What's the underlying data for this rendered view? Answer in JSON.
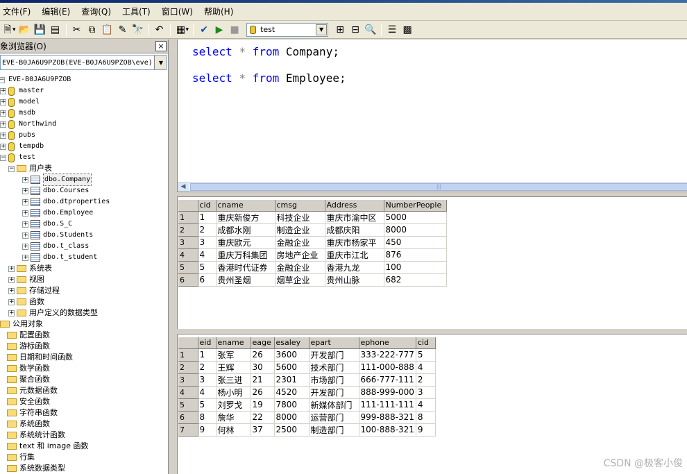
{
  "menu": [
    "文件(F)",
    "编辑(E)",
    "查询(Q)",
    "工具(T)",
    "窗口(W)",
    "帮助(H)"
  ],
  "toolbar": {
    "database": "test"
  },
  "object_browser": {
    "title": "象浏览器(O)",
    "close": "×",
    "server_combo": "EVE-B0JA6U9PZOB(EVE-B0JA6U9PZOB\\eve)",
    "server": "EVE-B0JA6U9PZOB",
    "databases": [
      "master",
      "model",
      "msdb",
      "Northwind",
      "pubs",
      "tempdb",
      "test"
    ],
    "user_tables_label": "用户表",
    "tables": [
      "dbo.Company",
      "dbo.Courses",
      "dbo.dtproperties",
      "dbo.Employee",
      "dbo.S_C",
      "dbo.Students",
      "dbo.t_class",
      "dbo.t_student"
    ],
    "test_folders": [
      "系统表",
      "视图",
      "存储过程",
      "函数",
      "用户定义的数据类型"
    ],
    "common_objects_label": "公用对象",
    "common_folders": [
      "配置函数",
      "游标函数",
      "日期和时间函数",
      "数学函数",
      "聚合函数",
      "元数据函数",
      "安全函数",
      "字符串函数",
      "系统函数",
      "系统统计函数",
      "text 和 image 函数",
      "行集",
      "系统数据类型"
    ]
  },
  "editor": {
    "line1": {
      "kw1": "select",
      "star": "*",
      "kw2": "from",
      "table": "Company;"
    },
    "line2": {
      "kw1": "select",
      "star": "*",
      "kw2": "from",
      "table": "Employee;"
    }
  },
  "grid1": {
    "columns": [
      "cid",
      "cname",
      "cmsg",
      "Address",
      "NumberPeople"
    ],
    "rows": [
      [
        "1",
        "1",
        "重庆新俊方",
        "科技企业",
        "重庆市渝中区",
        "5000"
      ],
      [
        "2",
        "2",
        "成都水刚",
        "制造企业",
        "成都庆阳",
        "8000"
      ],
      [
        "3",
        "3",
        "重庆欧元",
        "金融企业",
        "重庆市杨家平",
        "450"
      ],
      [
        "4",
        "4",
        "重庆万科集团",
        "房地产企业",
        "重庆市江北",
        "876"
      ],
      [
        "5",
        "5",
        "香港时代证券",
        "金融企业",
        "香港九龙",
        "100"
      ],
      [
        "6",
        "6",
        "贵州圣烟",
        "烟草企业",
        "贵州山脉",
        "682"
      ]
    ]
  },
  "grid2": {
    "columns": [
      "eid",
      "ename",
      "eage",
      "esaley",
      "epart",
      "ephone",
      "cid"
    ],
    "rows": [
      [
        "1",
        "1",
        "张军",
        "26",
        "3600",
        "开发部门",
        "333-222-777",
        "5"
      ],
      [
        "2",
        "2",
        "王辉",
        "30",
        "5600",
        "技术部门",
        "111-000-888",
        "4"
      ],
      [
        "3",
        "3",
        "张三进",
        "21",
        "2301",
        "市场部门",
        "666-777-111",
        "2"
      ],
      [
        "4",
        "4",
        "杨小明",
        "26",
        "4520",
        "开发部门",
        "888-999-000",
        "3"
      ],
      [
        "5",
        "5",
        "刘罗戈",
        "19",
        "7800",
        "新媒体部门",
        "111-111-111",
        "4"
      ],
      [
        "6",
        "8",
        "詹华",
        "22",
        "8000",
        "运营部门",
        "999-888-321",
        "8"
      ],
      [
        "7",
        "9",
        "何林",
        "37",
        "2500",
        "制造部门",
        "100-888-321",
        "9"
      ]
    ]
  },
  "watermark": "CSDN @极客小俊"
}
